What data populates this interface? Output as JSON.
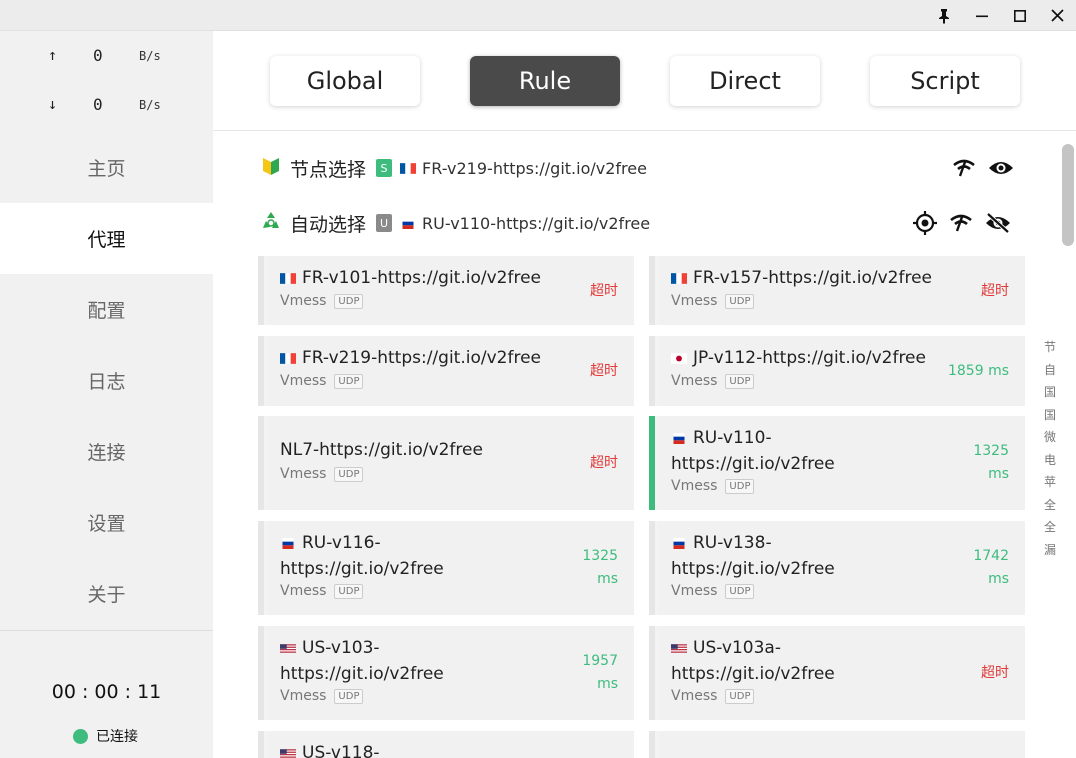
{
  "titlebar": {
    "pin": "pin-icon",
    "minimize": "minimize-icon",
    "maximize": "maximize-icon",
    "close": "close-icon"
  },
  "speed": {
    "up_arrow": "↑",
    "up_value": "0",
    "up_unit": "B/s",
    "down_arrow": "↓",
    "down_value": "0",
    "down_unit": "B/s"
  },
  "nav": {
    "items": [
      {
        "label": "主页"
      },
      {
        "label": "代理"
      },
      {
        "label": "配置"
      },
      {
        "label": "日志"
      },
      {
        "label": "连接"
      },
      {
        "label": "设置"
      },
      {
        "label": "关于"
      }
    ],
    "active_index": 1
  },
  "status": {
    "timer": "00 : 00 : 11",
    "connected": "已连接"
  },
  "modes": [
    {
      "label": "Global"
    },
    {
      "label": "Rule"
    },
    {
      "label": "Direct"
    },
    {
      "label": "Script"
    }
  ],
  "active_mode": "Rule",
  "groups": [
    {
      "icon": "🔰",
      "name": "节点选择",
      "badge": "S",
      "badge_color": "#3dbc7e",
      "now_flag": "FR",
      "now": "FR-v219-https://git.io/v2free"
    },
    {
      "icon": "♻️",
      "name": "自动选择",
      "badge": "U",
      "badge_color": "#8a8a8a",
      "now_flag": "RU",
      "now": "RU-v110-https://git.io/v2free"
    }
  ],
  "proxies": [
    {
      "flag": "FR",
      "name_line1": "FR-v101-https://git.io/v2free",
      "name_line2": "",
      "type": "Vmess",
      "udp": "UDP",
      "delay_line1": "超时",
      "delay_line2": "",
      "status": "timeout"
    },
    {
      "flag": "FR",
      "name_line1": "FR-v157-https://git.io/v2free",
      "name_line2": "",
      "type": "Vmess",
      "udp": "UDP",
      "delay_line1": "超时",
      "delay_line2": "",
      "status": "timeout"
    },
    {
      "flag": "FR",
      "name_line1": "FR-v219-https://git.io/v2free",
      "name_line2": "",
      "type": "Vmess",
      "udp": "UDP",
      "delay_line1": "超时",
      "delay_line2": "",
      "status": "timeout"
    },
    {
      "flag": "JP",
      "name_line1": "JP-v112-https://git.io/v2free",
      "name_line2": "",
      "type": "Vmess",
      "udp": "UDP",
      "delay_line1": "1859 ms",
      "delay_line2": "",
      "status": "ok"
    },
    {
      "flag": "",
      "name_line1": "NL7-https://git.io/v2free",
      "name_line2": "",
      "type": "Vmess",
      "udp": "UDP",
      "delay_line1": "超时",
      "delay_line2": "",
      "status": "timeout"
    },
    {
      "flag": "RU",
      "name_line1": "RU-v110-",
      "name_line2": "https://git.io/v2free",
      "type": "Vmess",
      "udp": "UDP",
      "delay_line1": "1325",
      "delay_line2": "ms",
      "status": "ok",
      "selected": true
    },
    {
      "flag": "RU",
      "name_line1": "RU-v116-",
      "name_line2": "https://git.io/v2free",
      "type": "Vmess",
      "udp": "UDP",
      "delay_line1": "1325",
      "delay_line2": "ms",
      "status": "ok"
    },
    {
      "flag": "RU",
      "name_line1": "RU-v138-",
      "name_line2": "https://git.io/v2free",
      "type": "Vmess",
      "udp": "UDP",
      "delay_line1": "1742",
      "delay_line2": "ms",
      "status": "ok"
    },
    {
      "flag": "US",
      "name_line1": "US-v103-",
      "name_line2": "https://git.io/v2free",
      "type": "Vmess",
      "udp": "UDP",
      "delay_line1": "1957",
      "delay_line2": "ms",
      "status": "ok"
    },
    {
      "flag": "US",
      "name_line1": "US-v103a-",
      "name_line2": "https://git.io/v2free",
      "type": "Vmess",
      "udp": "UDP",
      "delay_line1": "超时",
      "delay_line2": "",
      "status": "timeout"
    },
    {
      "flag": "US",
      "name_line1": "US-v118-",
      "name_line2": "",
      "type": "",
      "udp": "",
      "delay_line1": "",
      "delay_line2": "",
      "status": "timeout"
    },
    {
      "flag": "",
      "name_line1": "",
      "name_line2": "",
      "type": "",
      "udp": "",
      "delay_line1": "",
      "delay_line2": "",
      "status": "timeout"
    }
  ],
  "alpha_index": [
    "节",
    "自",
    "国",
    "国",
    "微",
    "电",
    "苹",
    "全",
    "全",
    "漏"
  ],
  "colors": {
    "accent": "#3dbc7e",
    "timeout": "#e03a3a",
    "active_mode_bg": "#4a4a4a"
  }
}
